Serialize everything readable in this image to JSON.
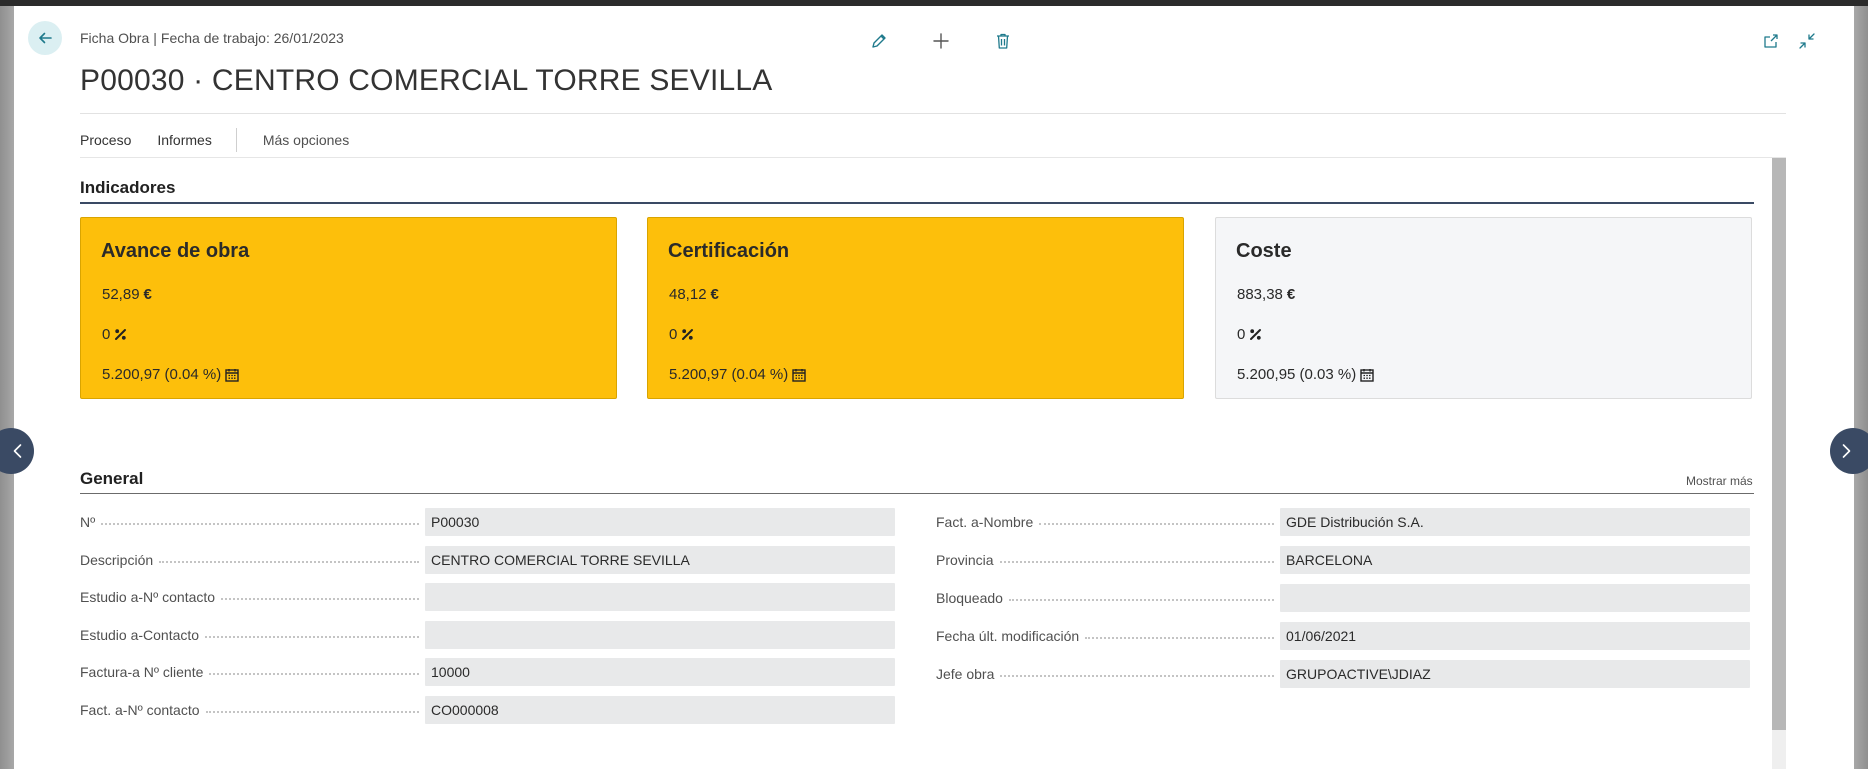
{
  "header": {
    "breadcrumb": {
      "page_type": "Ficha Obra",
      "separator": "|",
      "work_date": "Fecha de trabajo: 26/01/2023"
    },
    "title": "P00030 · CENTRO COMERCIAL TORRE SEVILLA",
    "icons": {
      "back": "arrow-left-icon",
      "edit": "pencil-icon",
      "new": "plus-icon",
      "delete": "trash-icon",
      "open_new_window": "open-in-new-window-icon",
      "collapse": "collapse-icon"
    }
  },
  "menubar": {
    "items": [
      "Proceso",
      "Informes"
    ],
    "more": "Más opciones"
  },
  "indicators": {
    "title": "Indicadores",
    "tiles": [
      {
        "title": "Avance de obra",
        "amount": "52,89",
        "amount_unit": "€",
        "percent": "0",
        "total": "5.200,97 (0.04 %)",
        "color": "#fdbf0b"
      },
      {
        "title": "Certificación",
        "amount": "48,12",
        "amount_unit": "€",
        "percent": "0",
        "total": "5.200,97 (0.04 %)",
        "color": "#fdbf0b"
      },
      {
        "title": "Coste",
        "amount": "883,38",
        "amount_unit": "€",
        "percent": "0",
        "total": "5.200,95 (0.03 %)",
        "color": "#f5f6f8"
      }
    ]
  },
  "general": {
    "title": "General",
    "show_more": "Mostrar más",
    "left_fields": [
      {
        "label": "Nº",
        "value": "P00030"
      },
      {
        "label": "Descripción",
        "value": "CENTRO COMERCIAL TORRE SEVILLA"
      },
      {
        "label": "Estudio a-Nº contacto",
        "value": ""
      },
      {
        "label": "Estudio a-Contacto",
        "value": ""
      },
      {
        "label": "Factura-a Nº cliente",
        "value": "10000"
      },
      {
        "label": "Fact. a-Nº contacto",
        "value": "CO000008"
      }
    ],
    "right_fields": [
      {
        "label": "Fact. a-Nombre",
        "value": "GDE Distribución S.A."
      },
      {
        "label": "Provincia",
        "value": "BARCELONA"
      },
      {
        "label": "Bloqueado",
        "value": ""
      },
      {
        "label": "Fecha últ. modificación",
        "value": "01/06/2021"
      },
      {
        "label": "Jefe obra",
        "value": "GRUPOACTIVE\\JDIAZ"
      }
    ]
  },
  "colors": {
    "accent": "#3a4a64",
    "tile_highlight": "#fdbf0b",
    "action_icon": "#1f7a8c",
    "field_background": "#e8e9ea"
  }
}
